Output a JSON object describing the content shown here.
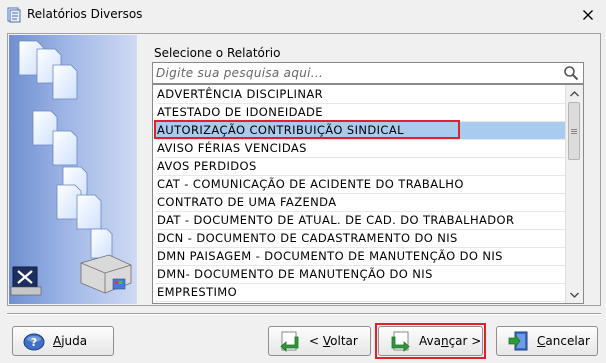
{
  "window": {
    "title": "Relatórios Diversos",
    "title_icon": "window-app-icon",
    "close_icon": "close-icon"
  },
  "form": {
    "select_label": "Selecione o Relatório",
    "search_placeholder": "Digite sua pesquisa aqui...",
    "search_icon": "search-icon"
  },
  "reports": [
    "ADVERTÊNCIA DISCIPLINAR",
    "ATESTADO DE IDONEIDADE",
    "AUTORIZAÇÃO CONTRIBUIÇÃO SINDICAL",
    "AVISO FÉRIAS VENCIDAS",
    "AVOS PERDIDOS",
    "CAT - COMUNICAÇÃO DE ACIDENTE DO TRABALHO",
    "CONTRATO DE UMA FAZENDA",
    "DAT - DOCUMENTO DE ATUAL. DE CAD. DO TRABALHADOR",
    "DCN - DOCUMENTO DE CADASTRAMENTO DO NIS",
    "DMN PAISAGEM - DOCUMENTO DE MANUTENÇÃO DO NIS",
    "DMN- DOCUMENTO DE MANUTENÇÃO DO NIS",
    "EMPRESTIMO"
  ],
  "selected_index": 2,
  "buttons": {
    "help": {
      "pre": "",
      "u": "A",
      "post": "juda"
    },
    "back": {
      "pre": "< ",
      "u": "V",
      "post": "oltar"
    },
    "next": {
      "pre": "Ava",
      "u": "n",
      "post": "çar >"
    },
    "cancel": {
      "pre": "",
      "u": "C",
      "post": "ancelar"
    }
  },
  "colors": {
    "selection": "#a9cbee",
    "highlight_outline": "#e0202a",
    "side_art": "#7d9ad6"
  }
}
